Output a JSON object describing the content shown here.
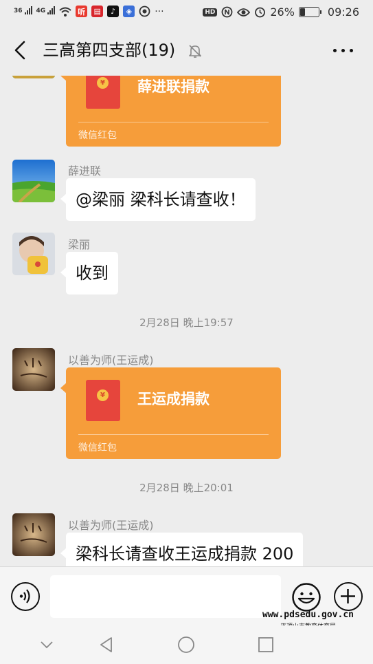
{
  "status_bar": {
    "signal_1": "36",
    "signal_2": "4G",
    "app_icon_1": "听",
    "battery_percent": "26%",
    "time": "09:26",
    "battery_level": 0.26,
    "icons": [
      "signal-icon",
      "wifi-icon",
      "hd-icon",
      "nfc-icon",
      "eye-icon",
      "alarm-icon",
      "battery-icon"
    ]
  },
  "header": {
    "title": "三高第四支部(19)",
    "icons": [
      "back-arrow-icon",
      "mute-bell-icon",
      "more-icon"
    ]
  },
  "messages": {
    "m1": {
      "type": "red_packet",
      "title": "薛进联捐款",
      "label": "微信红包"
    },
    "m2": {
      "type": "text",
      "sender": "薛进联",
      "text": "@梁丽  梁科长请查收！",
      "avatar": "landscape-avatar"
    },
    "m3": {
      "type": "text",
      "sender": "梁丽",
      "text": "收到",
      "avatar": "child-avatar"
    },
    "t1": {
      "type": "timestamp",
      "text": "2月28日 晚上19:57"
    },
    "m4": {
      "type": "red_packet",
      "sender": "以善为师(王运成)",
      "title": "王运成捐款",
      "label": "微信红包",
      "avatar": "calligraphy-avatar"
    },
    "t2": {
      "type": "timestamp",
      "text": "2月28日 晚上20:01"
    },
    "m5": {
      "type": "text",
      "sender": "以善为师(王运成)",
      "text": "梁科长请查收王运成捐款 200",
      "avatar": "calligraphy-avatar"
    }
  },
  "input_bar": {
    "placeholder": "",
    "icons": [
      "voice-icon",
      "emoji-icon",
      "plus-icon"
    ]
  },
  "watermark": {
    "url": "www.pdsedu.gov.cn",
    "org": "平顶山市教育体育局"
  },
  "colors": {
    "background": "#ededed",
    "red_packet": "#f69d3a",
    "envelope": "#e6453c",
    "bubble": "#ffffff"
  }
}
